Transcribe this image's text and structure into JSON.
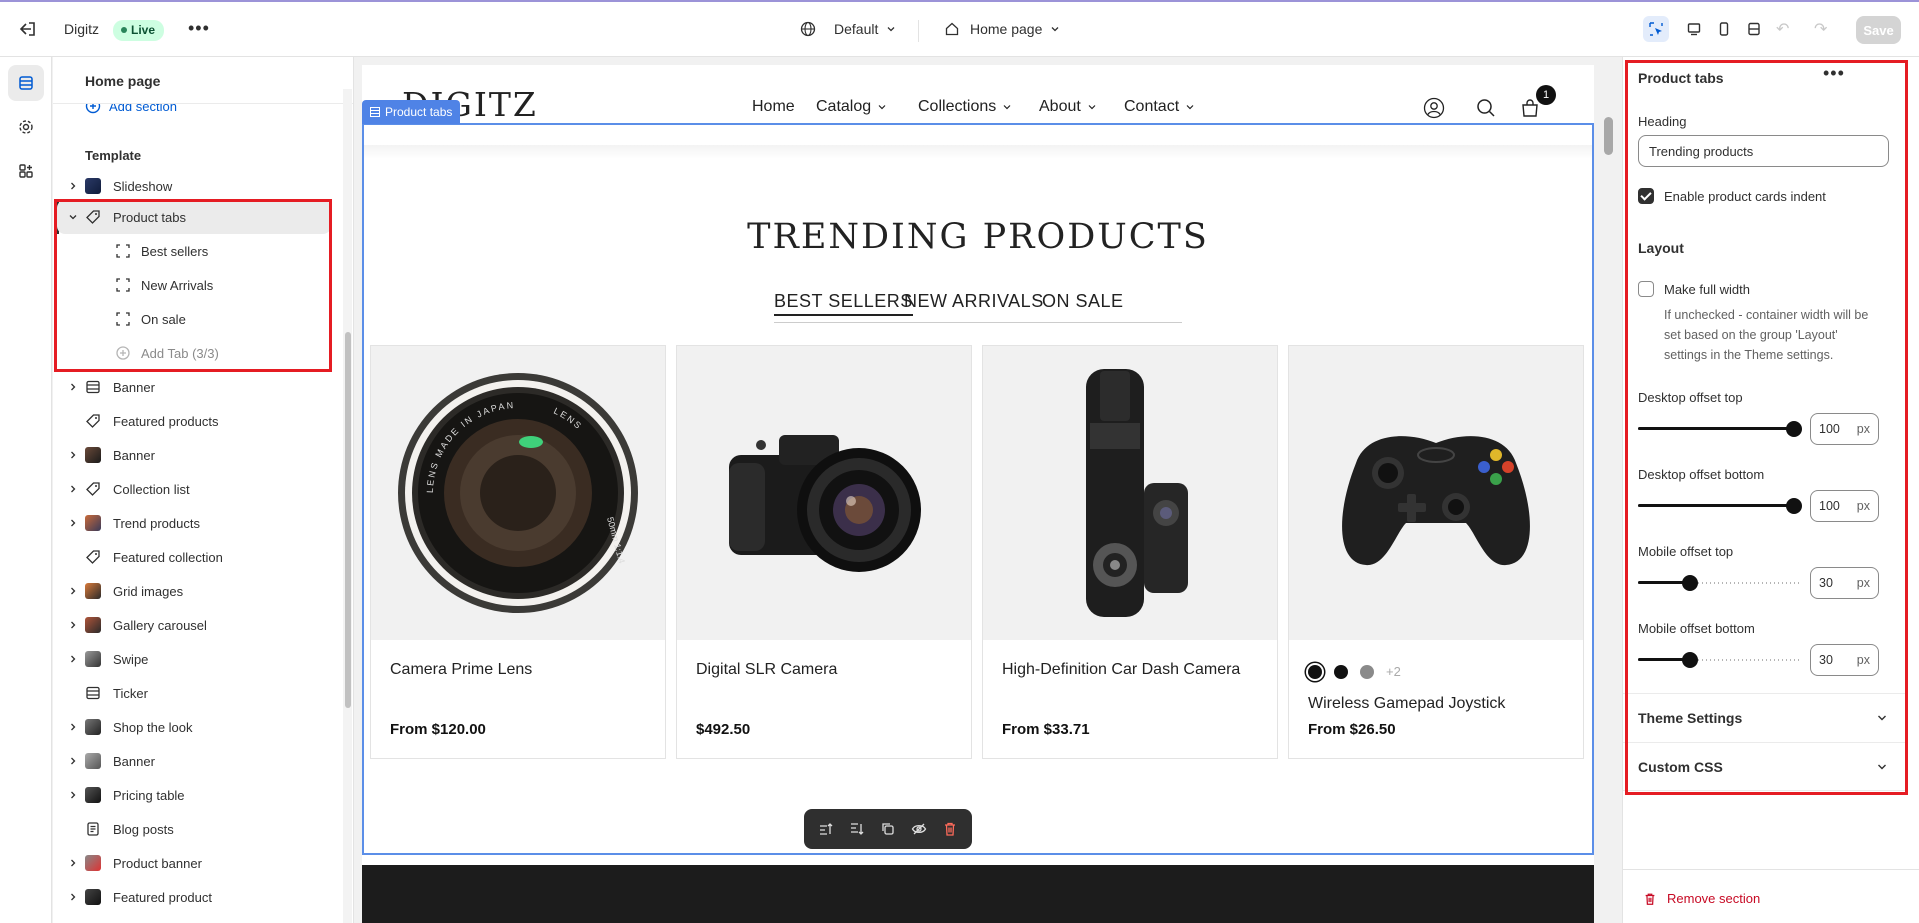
{
  "topbar": {
    "store_name": "Digitz",
    "status_badge": "Live",
    "theme_selector": "Default",
    "page_selector": "Home page",
    "save_label": "Save"
  },
  "tree": {
    "title": "Home page",
    "add_section": "Add section",
    "template_label": "Template",
    "items": [
      {
        "label": "Slideshow"
      },
      {
        "label": "Product tabs"
      },
      {
        "label": "Best sellers"
      },
      {
        "label": "New Arrivals"
      },
      {
        "label": "On sale"
      },
      {
        "label": "Add Tab (3/3)"
      },
      {
        "label": "Banner"
      },
      {
        "label": "Featured products"
      },
      {
        "label": "Banner"
      },
      {
        "label": "Collection list"
      },
      {
        "label": "Trend products"
      },
      {
        "label": "Featured collection"
      },
      {
        "label": "Grid images"
      },
      {
        "label": "Gallery carousel"
      },
      {
        "label": "Swipe"
      },
      {
        "label": "Ticker"
      },
      {
        "label": "Shop the look"
      },
      {
        "label": "Banner"
      },
      {
        "label": "Pricing table"
      },
      {
        "label": "Blog posts"
      },
      {
        "label": "Product banner"
      },
      {
        "label": "Featured product"
      }
    ]
  },
  "preview": {
    "logo": "DIGITZ",
    "nav": [
      "Home",
      "Catalog",
      "Collections",
      "About",
      "Contact"
    ],
    "cart_count": "1",
    "section_label": "Product tabs",
    "section_title": "TRENDING PRODUCTS",
    "tabs": [
      "BEST SELLERS",
      "NEW ARRIVALS",
      "ON SALE"
    ],
    "products": [
      {
        "name": "Camera Prime Lens",
        "price": "From $120.00"
      },
      {
        "name": "Digital SLR Camera",
        "price": "$492.50"
      },
      {
        "name": "High-Definition Car Dash Camera",
        "price": "From $33.71"
      },
      {
        "name": "Wireless Gamepad Joystick",
        "price": "From $26.50",
        "more_swatches": "+2"
      }
    ],
    "lens_text": {
      "japan": "LENS MADE IN JAPAN",
      "spec": "50mm 1:1.4",
      "lens": "LENS"
    }
  },
  "panel": {
    "title": "Product tabs",
    "heading_label": "Heading",
    "heading_value": "Trending products",
    "indent_label": "Enable product cards indent",
    "indent_checked": true,
    "layout_heading": "Layout",
    "full_width_label": "Make full width",
    "full_width_checked": false,
    "full_width_help": "If unchecked - container width will be set based on the group 'Layout' settings in the Theme settings.",
    "sliders": [
      {
        "label": "Desktop offset top",
        "value": "100",
        "unit": "px",
        "fraction": 1.0
      },
      {
        "label": "Desktop offset bottom",
        "value": "100",
        "unit": "px",
        "fraction": 1.0
      },
      {
        "label": "Mobile offset top",
        "value": "30",
        "unit": "px",
        "fraction": 0.3
      },
      {
        "label": "Mobile offset bottom",
        "value": "30",
        "unit": "px",
        "fraction": 0.3
      }
    ],
    "theme_settings": "Theme Settings",
    "custom_css": "Custom CSS",
    "remove_section": "Remove section"
  },
  "colors": {
    "accent": "#005bd3",
    "section_outline": "#5b8ee8",
    "highlight": "#e51c23",
    "live_bg": "#cdfee1",
    "danger": "#c70a24"
  }
}
